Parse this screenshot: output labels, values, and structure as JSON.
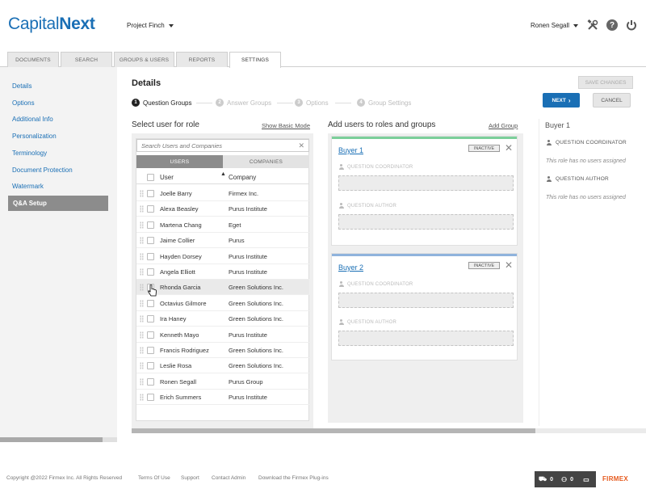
{
  "header": {
    "logo_part1": "Capital",
    "logo_part2": "Next",
    "project": "Project Finch",
    "user": "Ronen Segall"
  },
  "tabs": [
    "DOCUMENTS",
    "SEARCH",
    "GROUPS & USERS",
    "REPORTS",
    "SETTINGS"
  ],
  "active_tab": "SETTINGS",
  "sidebar": {
    "items": [
      "Details",
      "Options",
      "Additional Info",
      "Personalization",
      "Terminology",
      "Document Protection",
      "Watermark",
      "Q&A Setup"
    ],
    "active": "Q&A Setup"
  },
  "main": {
    "title": "Details",
    "save_label": "SAVE CHANGES",
    "next_label": "NEXT",
    "cancel_label": "CANCEL",
    "steps": [
      {
        "num": "1",
        "label": "Question Groups"
      },
      {
        "num": "2",
        "label": "Answer Groups"
      },
      {
        "num": "3",
        "label": "Options"
      },
      {
        "num": "4",
        "label": "Group Settings"
      }
    ]
  },
  "users_section": {
    "title": "Select user for role",
    "link": "Show Basic Mode",
    "search_placeholder": "Search Users and Companies",
    "tab_users": "USERS",
    "tab_companies": "COMPANIES",
    "col_user": "User",
    "col_company": "Company",
    "rows": [
      {
        "user": "Joelle Barry",
        "company": "Firmex Inc."
      },
      {
        "user": "Alexa Beasley",
        "company": "Purus Institute"
      },
      {
        "user": "Martena Chang",
        "company": "Eget"
      },
      {
        "user": "Jaime Collier",
        "company": "Purus"
      },
      {
        "user": "Hayden Dorsey",
        "company": "Purus Institute"
      },
      {
        "user": "Angela Elliott",
        "company": "Purus Institute"
      },
      {
        "user": "Rhonda Garcia",
        "company": "Green Solutions Inc."
      },
      {
        "user": "Octavius Gilmore",
        "company": "Green Solutions Inc."
      },
      {
        "user": "Ira Haney",
        "company": "Green Solutions Inc."
      },
      {
        "user": "Kenneth Mayo",
        "company": "Purus Institute"
      },
      {
        "user": "Francis Rodriguez",
        "company": "Green Solutions Inc."
      },
      {
        "user": "Leslie Rosa",
        "company": "Green Solutions Inc."
      },
      {
        "user": "Ronen Segall",
        "company": "Purus Group"
      },
      {
        "user": "Erich Summers",
        "company": "Purus Institute"
      }
    ]
  },
  "roles_section": {
    "title": "Add users to roles and groups",
    "link": "Add Group",
    "groups": [
      {
        "name": "Buyer 1",
        "status": "INACTIVE",
        "color": "#7ccf9a",
        "role1": "QUESTION COORDINATOR",
        "role2": "QUESTION AUTHOR"
      },
      {
        "name": "Buyer 2",
        "status": "INACTIVE",
        "color": "#8fb3dc",
        "role1": "QUESTION COORDINATOR",
        "role2": "QUESTION AUTHOR"
      }
    ]
  },
  "summary": {
    "title": "Buyer 1",
    "role1": "QUESTION COORDINATOR",
    "empty1": "This role has no users assigned",
    "role2": "QUESTION AUTHOR",
    "empty2": "This role has no users assigned"
  },
  "footer": {
    "copyright": "Copyright @2022 Firmex Inc. All Rights Reserved",
    "links": [
      "Terms Of Use",
      "Support",
      "Contact Admin",
      "Download the Firmex Plug-ins"
    ],
    "count_a": "0",
    "count_b": "0",
    "brand": "FIRMEX"
  }
}
